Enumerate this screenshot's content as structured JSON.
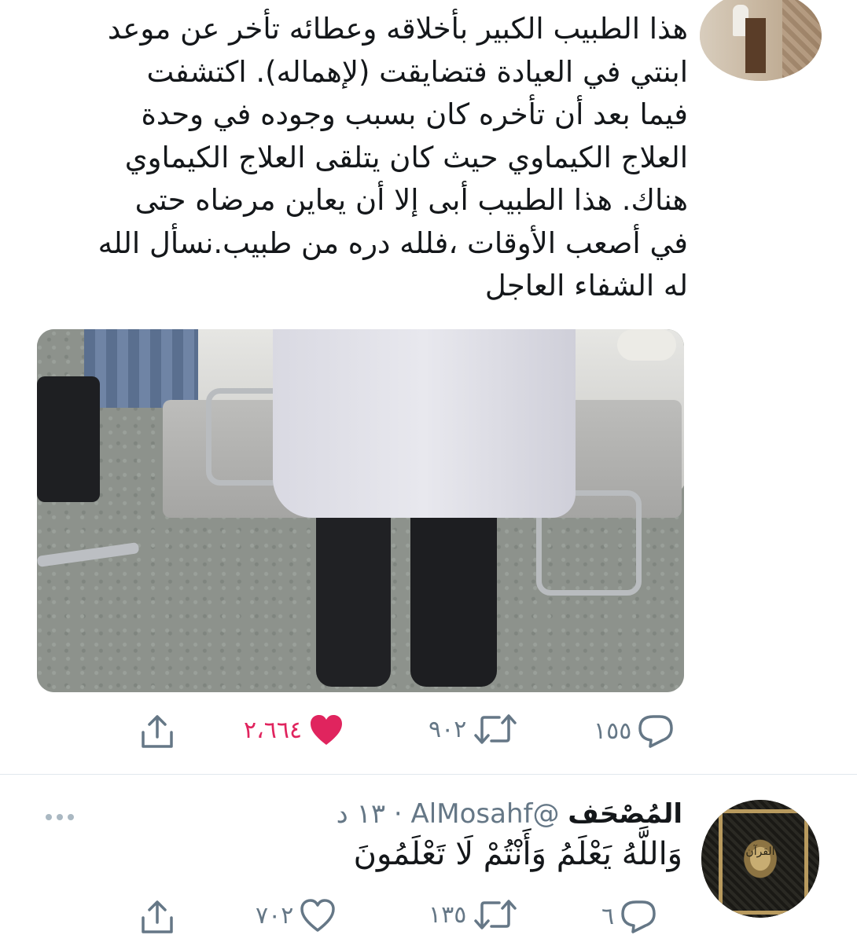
{
  "tweet1": {
    "text_lines": [
      "هذا الطبيب الكبير بأخلاقه وعطائه تأخر عن موعد",
      "ابنتي في العيادة فتضايقت (لإهماله). اكتشفت",
      "فيما بعد أن تأخره كان بسبب وجوده في وحدة",
      "العلاج الكيماوي حيث كان يتلقى العلاج الكيماوي",
      "هناك. هذا الطبيب أبى إلا أن يعاين مرضاه حتى",
      "في أصعب الأوقات ،فلله دره من طبيب.نسأل الله",
      "له الشفاء العاجل"
    ],
    "media_icon": "photo-of-doctor-in-chemo-unit",
    "replies": "١٥٥",
    "retweets": "٩٠٢",
    "likes": "٢،٦٦٤",
    "liked": true
  },
  "tweet2": {
    "display_name": "المُصْحَف",
    "handle": "@AlMosahf",
    "time": "١٣ د",
    "separator": "·",
    "text": "وَاللَّهُ يَعْلَمُ وَأَنْتُمْ لَا تَعْلَمُونَ",
    "avatar_text": "القرآن",
    "replies": "٦",
    "retweets": "١٣٥",
    "likes": "٧٠٢",
    "liked": false
  },
  "colors": {
    "like": "#e0245e",
    "icon": "#657786",
    "text": "#14171a"
  },
  "icons": [
    "share-icon",
    "heart-icon",
    "retweet-icon",
    "reply-icon",
    "more-icon"
  ]
}
